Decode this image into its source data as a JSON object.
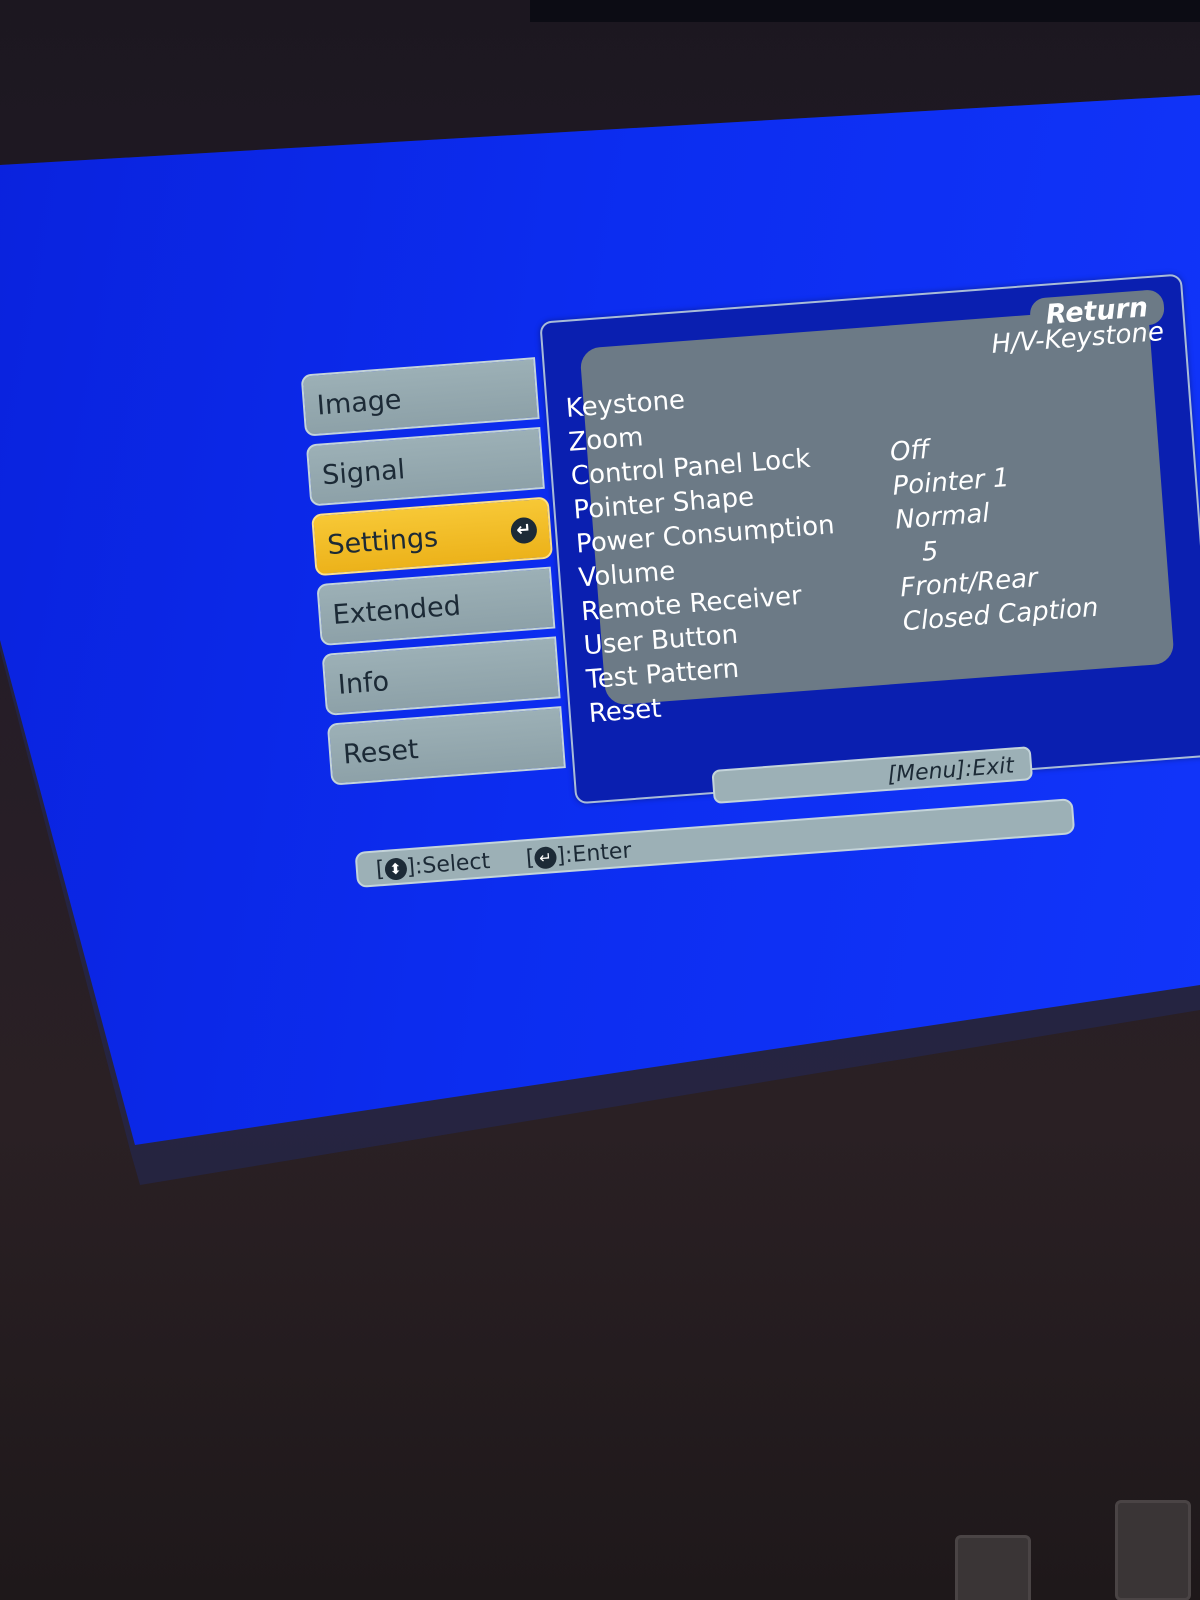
{
  "tabs": [
    {
      "label": "Image"
    },
    {
      "label": "Signal"
    },
    {
      "label": "Settings"
    },
    {
      "label": "Extended"
    },
    {
      "label": "Info"
    },
    {
      "label": "Reset"
    }
  ],
  "active_tab": "Settings",
  "panel": {
    "return_label": "Return",
    "keystone_value": "H/V-Keystone",
    "rows": [
      {
        "label": "Keystone",
        "value": ""
      },
      {
        "label": "Zoom",
        "value": ""
      },
      {
        "label": "Control Panel Lock",
        "value": "Off"
      },
      {
        "label": "Pointer Shape",
        "value": "Pointer 1"
      },
      {
        "label": "Power Consumption",
        "value": "Normal"
      },
      {
        "label": "Volume",
        "value": "5"
      },
      {
        "label": "Remote Receiver",
        "value": "Front/Rear"
      },
      {
        "label": "User Button",
        "value": "Closed Caption"
      },
      {
        "label": "Test Pattern",
        "value": ""
      },
      {
        "label": "Reset",
        "value": ""
      }
    ]
  },
  "footer": {
    "exit_hint": "[Menu]:Exit",
    "select_hint_prefix": "[",
    "select_glyph": "⬍",
    "select_hint_suffix": "]:Select",
    "enter_hint_prefix": "[",
    "enter_glyph": "↵",
    "enter_hint_suffix": "]:Enter"
  },
  "colors": {
    "screen_blue": "#0c2df0",
    "panel_blue": "#0a1fb0",
    "panel_gray": "#6c7a86",
    "tab_gray": "#9cb0b6",
    "tab_active": "#f7c836"
  },
  "icons": {
    "enter": "enter-icon",
    "updown": "updown-arrow-icon"
  }
}
